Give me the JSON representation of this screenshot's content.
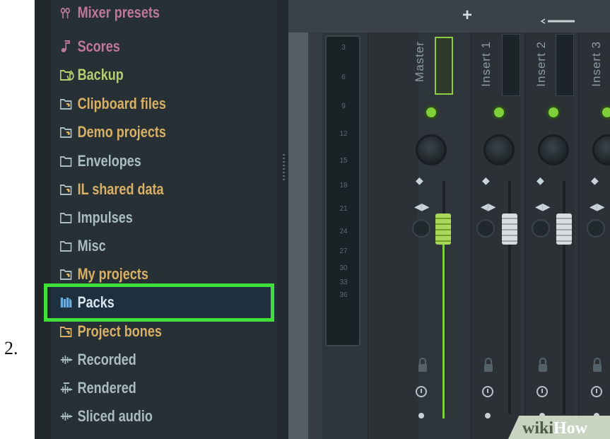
{
  "step_number": "2.",
  "browser": {
    "items": [
      {
        "label": "Mixer presets",
        "icon": "mixer-presets-icon",
        "color": "#c07897"
      },
      {
        "label": "Scores",
        "icon": "music-note-icon",
        "color": "#c07897"
      },
      {
        "label": "Backup",
        "icon": "backup-folder-icon",
        "color": "#b4d06e"
      },
      {
        "label": "Clipboard files",
        "icon": "folder-link-icon",
        "color": "#d9b064"
      },
      {
        "label": "Demo projects",
        "icon": "folder-link-icon",
        "color": "#d9b064"
      },
      {
        "label": "Envelopes",
        "icon": "folder-icon",
        "color": "#a9bcc0"
      },
      {
        "label": "IL shared data",
        "icon": "folder-link-icon",
        "color": "#d9b064"
      },
      {
        "label": "Impulses",
        "icon": "folder-icon",
        "color": "#a9bcc0"
      },
      {
        "label": "Misc",
        "icon": "folder-icon",
        "color": "#a9bcc0"
      },
      {
        "label": "My projects",
        "icon": "folder-link-icon",
        "color": "#d9b064"
      },
      {
        "label": "Packs",
        "icon": "packs-icon",
        "color": "#d7e6ee",
        "highlighted": true
      },
      {
        "label": "Project bones",
        "icon": "folder-link-icon",
        "color": "#d9b064"
      },
      {
        "label": "Recorded",
        "icon": "waveform-icon",
        "color": "#a9bcc0"
      },
      {
        "label": "Rendered",
        "icon": "rendered-waveform-icon",
        "color": "#a9bcc0"
      },
      {
        "label": "Sliced audio",
        "icon": "waveform-icon",
        "color": "#a9bcc0"
      }
    ]
  },
  "mixer": {
    "add_label": "+",
    "meter_ticks": [
      "3",
      "6",
      "9",
      "12",
      "15",
      "18",
      "21",
      "24",
      "27",
      "30",
      "33",
      "36"
    ],
    "tracks": [
      "Master",
      "Insert 1",
      "Insert 2",
      "Insert 3"
    ]
  },
  "watermark": {
    "part1": "wiki",
    "part2": "How"
  },
  "colors": {
    "highlight": "#3fe03a",
    "active_led": "#7fcf3a"
  }
}
